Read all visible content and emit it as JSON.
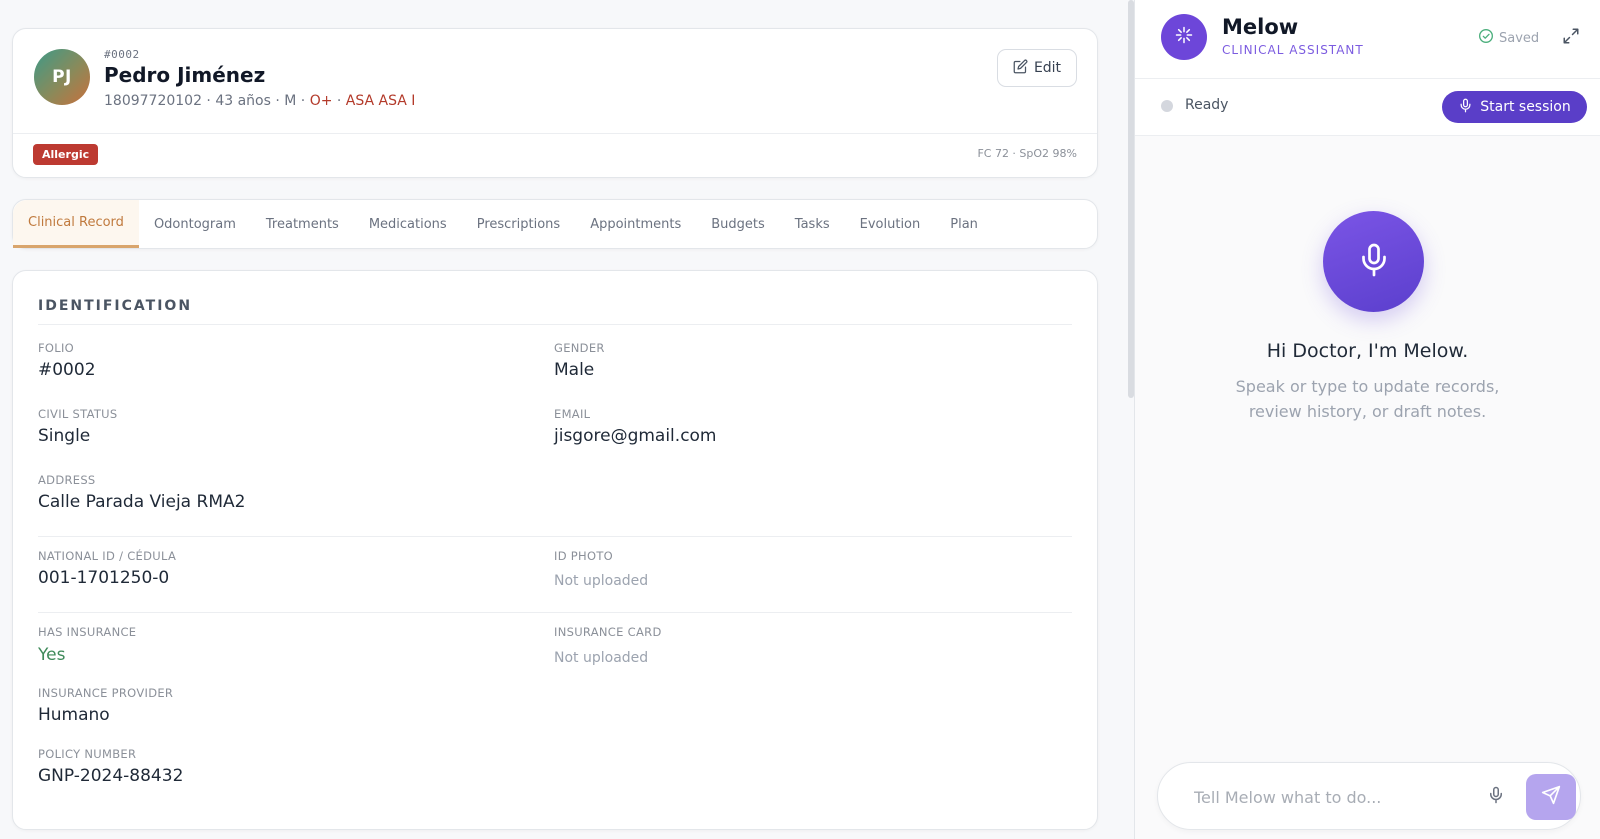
{
  "patient": {
    "initials": "PJ",
    "folio_tag": "#0002",
    "name": "Pedro Jiménez",
    "meta_plain": "18097720102 · 43 años · M · ",
    "blood_type": "O+",
    "meta_sep": " · ",
    "asa": "ASA ASA I",
    "edit_label": "Edit",
    "allergy_badge": "Allergic",
    "vitals": "FC 72 · SpO2 98%"
  },
  "tabs": [
    "Clinical Record",
    "Odontogram",
    "Treatments",
    "Medications",
    "Prescriptions",
    "Appointments",
    "Budgets",
    "Tasks",
    "Evolution",
    "Plan"
  ],
  "active_tab": "Clinical Record",
  "identification": {
    "title": "IDENTIFICATION",
    "folio_label": "FOLIO",
    "folio_value": "#0002",
    "gender_label": "GENDER",
    "gender_value": "Male",
    "civil_label": "CIVIL STATUS",
    "civil_value": "Single",
    "email_label": "EMAIL",
    "email_value": "jisgore@gmail.com",
    "address_label": "ADDRESS",
    "address_value": "Calle Parada Vieja RMA2",
    "national_id_label": "NATIONAL ID / CÉDULA",
    "national_id_value": "001-1701250-0",
    "id_photo_label": "ID PHOTO",
    "id_photo_value": "Not uploaded",
    "has_insurance_label": "HAS INSURANCE",
    "has_insurance_value": "Yes",
    "insurance_card_label": "INSURANCE CARD",
    "insurance_card_value": "Not uploaded",
    "provider_label": "INSURANCE PROVIDER",
    "provider_value": "Humano",
    "policy_label": "POLICY NUMBER",
    "policy_value": "GNP-2024-88432"
  },
  "assistant": {
    "name": "Melow",
    "subtitle": "CLINICAL ASSISTANT",
    "saved_label": "Saved",
    "status": "Ready",
    "start_label": "Start session",
    "greeting": "Hi Doctor, I'm Melow.",
    "sub_line1": "Speak or type to update records,",
    "sub_line2": "review history, or draft notes.",
    "input_placeholder": "Tell Melow what to do..."
  },
  "colors": {
    "accent_purple": "#5a3ec8",
    "allergy_red": "#bd3a31",
    "active_tab": "#c07a3e",
    "positive_green": "#3f8a5a"
  }
}
